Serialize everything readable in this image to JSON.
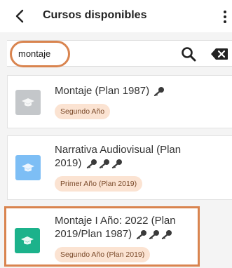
{
  "header": {
    "title": "Cursos disponibles",
    "back_icon": "chevron-left-icon",
    "more_icon": "more-vertical-icon"
  },
  "search": {
    "value": "montaje",
    "search_icon": "search-icon",
    "clear_icon": "backspace-clear-icon"
  },
  "courses": [
    {
      "title_lines": [
        "Montaje (Plan 1987)"
      ],
      "badge": "Segundo Año",
      "icon": "graduation-cap-icon",
      "icon_color": "#c4c7ca",
      "key_count": 1
    },
    {
      "title_lines": [
        "Narrativa Audiovisual (Plan",
        "2019)"
      ],
      "badge": "Primer Año (Plan 2019)",
      "icon": "graduation-cap-icon",
      "icon_color": "#7dbef5",
      "key_count": 3
    },
    {
      "title_lines": [
        "Montaje I Año: 2022 (Plan",
        "2019/Plan 1987)"
      ],
      "badge": "Segundo Año (Plan 2019)",
      "icon": "graduation-cap-icon",
      "icon_color": "#1cb28b",
      "key_count": 3,
      "highlighted": true
    }
  ],
  "colors": {
    "accent_highlight": "#d9844f",
    "badge_bg": "#fbe3d2",
    "badge_text": "#7a4a2a",
    "key_icon": "#3a3a3a"
  }
}
